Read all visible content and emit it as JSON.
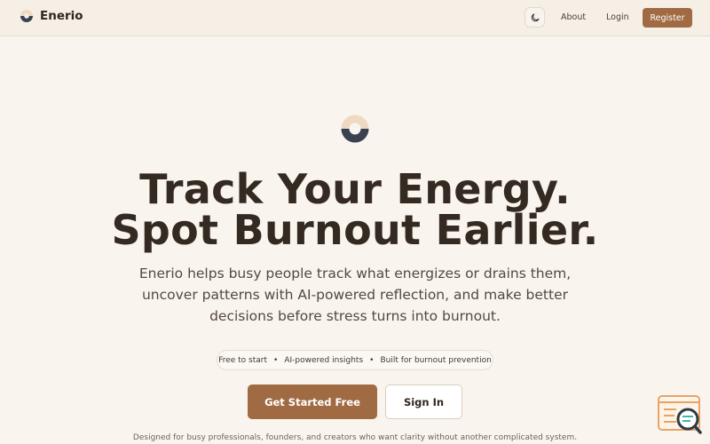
{
  "nav": {
    "brand": "Enerio",
    "theme_icon": "moon-icon",
    "about": "About",
    "login": "Login",
    "register": "Register"
  },
  "hero": {
    "headline_line1": "Track Your Energy.",
    "headline_line2": "Spot Burnout Earlier.",
    "subtitle_lines": [
      "Enerio helps busy people track what energizes or drains them,",
      "uncover patterns with AI-powered reflection, and make better",
      "decisions before stress turns into burnout."
    ],
    "pill": [
      "Free to start",
      "AI-powered insights",
      "Built for burnout prevention"
    ],
    "pill_separator": "•",
    "cta_primary": "Get Started Free",
    "cta_secondary": "Sign In",
    "footnote": "Designed for busy professionals, founders, and creators who want clarity without another complicated system."
  },
  "colors": {
    "accent": "#a06b43",
    "background": "#f9f5ee",
    "logo_light": "#efd9c3",
    "logo_dark": "#3b4150"
  }
}
